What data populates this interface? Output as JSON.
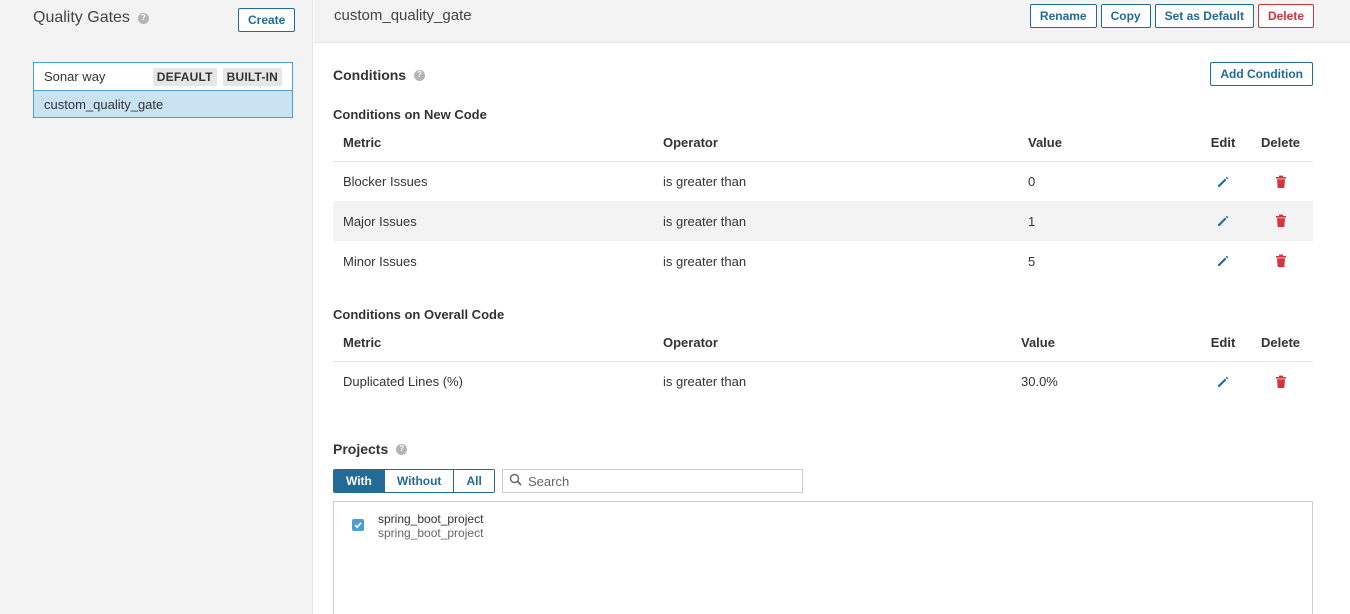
{
  "sidebar": {
    "title": "Quality Gates",
    "create_label": "Create",
    "gates": [
      {
        "name": "Sonar way",
        "badges": [
          "DEFAULT",
          "BUILT-IN"
        ],
        "selected": false
      },
      {
        "name": "custom_quality_gate",
        "badges": [],
        "selected": true
      }
    ]
  },
  "header": {
    "title": "custom_quality_gate",
    "rename_label": "Rename",
    "copy_label": "Copy",
    "set_default_label": "Set as Default",
    "delete_label": "Delete"
  },
  "conditions": {
    "title": "Conditions",
    "add_label": "Add Condition",
    "new_code": {
      "title": "Conditions on New Code",
      "headers": {
        "metric": "Metric",
        "operator": "Operator",
        "value": "Value",
        "edit": "Edit",
        "delete": "Delete"
      },
      "rows": [
        {
          "metric": "Blocker Issues",
          "operator": "is greater than",
          "value": "0"
        },
        {
          "metric": "Major Issues",
          "operator": "is greater than",
          "value": "1"
        },
        {
          "metric": "Minor Issues",
          "operator": "is greater than",
          "value": "5"
        }
      ]
    },
    "overall_code": {
      "title": "Conditions on Overall Code",
      "headers": {
        "metric": "Metric",
        "operator": "Operator",
        "value": "Value",
        "edit": "Edit",
        "delete": "Delete"
      },
      "rows": [
        {
          "metric": "Duplicated Lines (%)",
          "operator": "is greater than",
          "value": "30.0%"
        }
      ]
    }
  },
  "projects": {
    "title": "Projects",
    "filters": [
      "With",
      "Without",
      "All"
    ],
    "active_filter": "With",
    "search_placeholder": "Search",
    "items": [
      {
        "name": "spring_boot_project",
        "key": "spring_boot_project",
        "checked": true
      }
    ]
  },
  "colors": {
    "accent": "#236a97",
    "danger": "#d4333f",
    "selected_bg": "#cae3f2"
  }
}
